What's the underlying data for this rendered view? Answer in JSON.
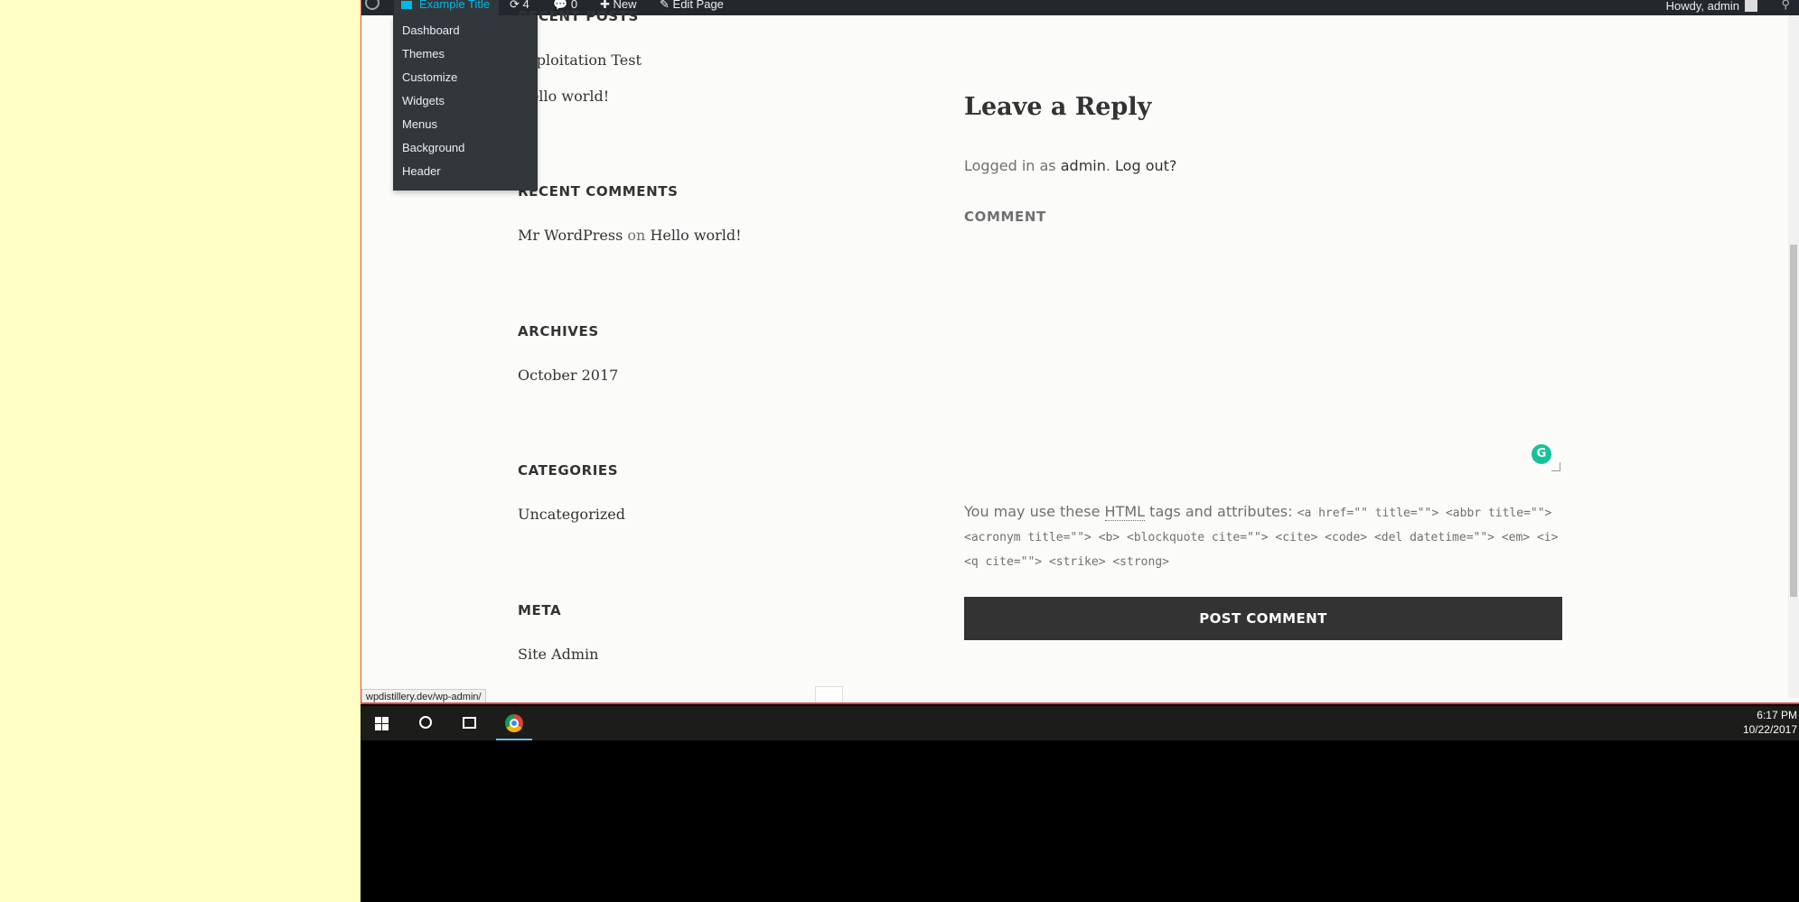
{
  "admin_bar": {
    "site_title": "Example Title",
    "updates_count": "4",
    "comments_count": "0",
    "new_label": "New",
    "edit_label": "Edit Page",
    "howdy": "Howdy, admin"
  },
  "site_menu": {
    "items": [
      "Dashboard",
      "Themes",
      "Customize",
      "Widgets",
      "Menus",
      "Background",
      "Header"
    ]
  },
  "widgets": {
    "recent_posts": {
      "title": "RECENT POSTS",
      "items": [
        "Exploitation Test",
        "Hello world!"
      ]
    },
    "recent_comments": {
      "title": "RECENT COMMENTS",
      "author": "Mr WordPress",
      "on": "on",
      "post": "Hello world!"
    },
    "archives": {
      "title": "ARCHIVES",
      "items": [
        "October 2017"
      ]
    },
    "categories": {
      "title": "CATEGORIES",
      "items": [
        "Uncategorized"
      ]
    },
    "meta": {
      "title": "META",
      "items": [
        "Site Admin"
      ]
    }
  },
  "reply": {
    "title": "Leave a Reply",
    "logged_in_prefix": "Logged in as",
    "user": "admin",
    "logout": "Log out?",
    "comment_label": "COMMENT",
    "comment_value": "",
    "allowed_prefix": "You may use these",
    "html_abbr": "HTML",
    "allowed_mid": "tags and attributes:",
    "allowed_tags": "<a href=\"\" title=\"\"> <abbr title=\"\"> <acronym title=\"\"> <b> <blockquote cite=\"\"> <cite> <code> <del datetime=\"\"> <em> <i> <q cite=\"\"> <strike> <strong>",
    "post_button": "POST COMMENT"
  },
  "status_url": "wpdistillery.dev/wp-admin/",
  "taskbar": {
    "time": "6:17 PM",
    "date": "10/22/2017"
  }
}
